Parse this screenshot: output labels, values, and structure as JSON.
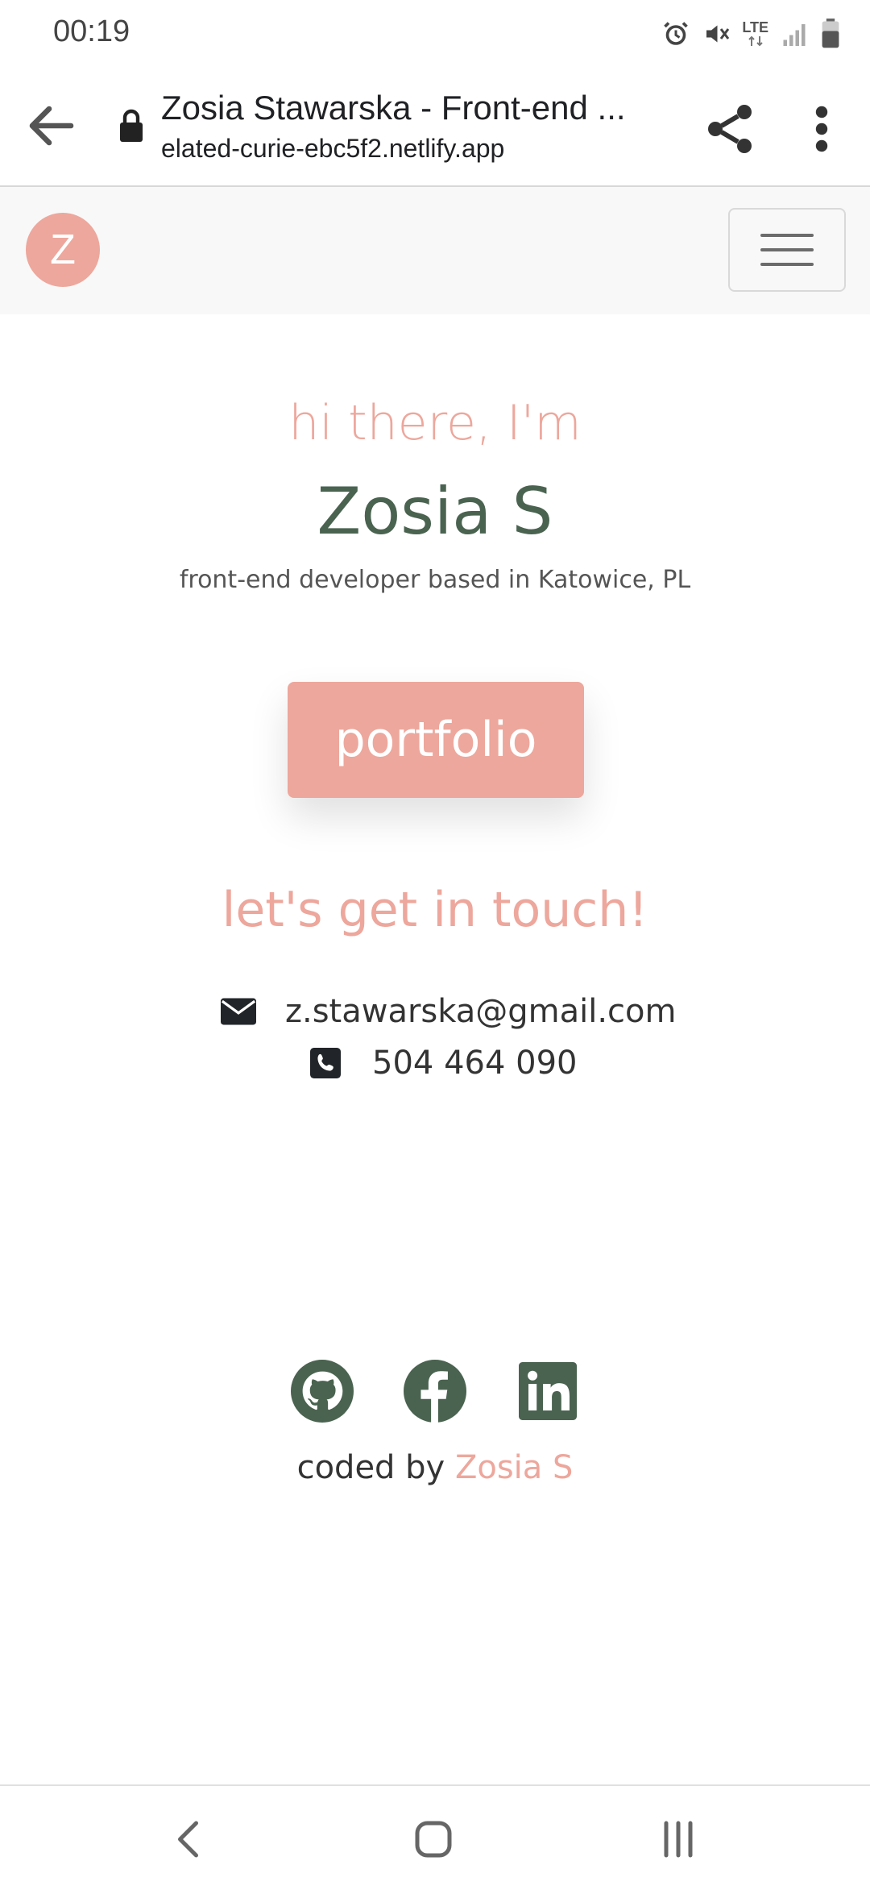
{
  "status_bar": {
    "time": "00:19",
    "network_label": "LTE",
    "icons": [
      "alarm-icon",
      "mute-icon",
      "lte-icon",
      "signal-icon",
      "battery-icon"
    ]
  },
  "browser": {
    "page_title": "Zosia Stawarska - Front-end ...",
    "url": "elated-curie-ebc5f2.netlify.app",
    "icons": [
      "back-arrow-icon",
      "lock-icon",
      "share-icon",
      "more-vert-icon"
    ]
  },
  "navbar": {
    "logo_letter": "Z",
    "menu_icon": "hamburger-icon"
  },
  "hero": {
    "greeting": "hi there, I'm",
    "name": "Zosia S",
    "subtitle": "front-end developer based in Katowice, PL",
    "cta_label": "portfolio"
  },
  "contact": {
    "heading": "let's get in touch!",
    "email": "z.stawarska@gmail.com",
    "phone": "504 464 090"
  },
  "footer": {
    "social_icons": [
      "github-icon",
      "facebook-icon",
      "linkedin-icon"
    ],
    "coded_by_prefix": "coded by",
    "coded_by_author": "Zosia S"
  },
  "colors": {
    "accent_pink": "#eda79c",
    "accent_green": "#4a6350",
    "navbar_bg": "#f8f8f8"
  },
  "system_nav": {
    "buttons": [
      "nav-back-icon",
      "nav-home-icon",
      "nav-recents-icon"
    ]
  }
}
